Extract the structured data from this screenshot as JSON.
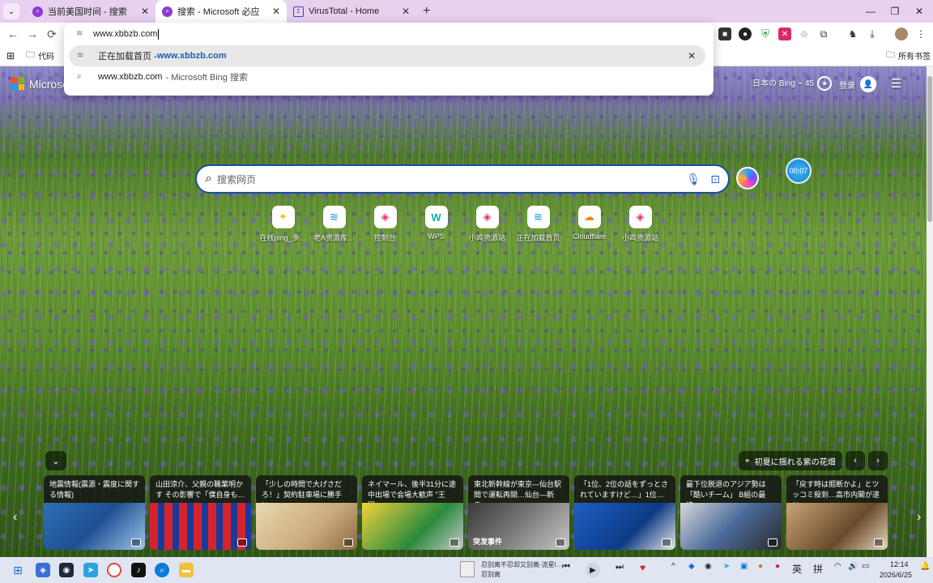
{
  "tabs": [
    {
      "title": "当前美国时间 - 搜索",
      "close": "✕"
    },
    {
      "title": "搜索 - Microsoft 必应",
      "close": "✕"
    },
    {
      "title": "VirusTotal - Home",
      "close": "✕"
    }
  ],
  "new_tab": "+",
  "window": {
    "min": "—",
    "max": "❐",
    "close": "✕"
  },
  "nav": {
    "back": "←",
    "forward": "→",
    "reload": "⟳"
  },
  "bookmarks": {
    "left_folder": "代码",
    "right_folder": "所有书签"
  },
  "omnibox": {
    "input_value": "www.xbbzb.com",
    "suggestions": [
      {
        "prefix": "正在加载首页 - ",
        "url": "www.xbbzb.com",
        "close": "✕"
      },
      {
        "prefix": "www.xbbzb.com",
        "sub": "- Microsoft Bing 搜索"
      }
    ]
  },
  "bing": {
    "brand": "Microsoft",
    "region": "日本の Bing",
    "chevron": "⌄",
    "points": "45",
    "signin": "登录",
    "menu": "☰",
    "search_placeholder": "搜索网页",
    "timer": "00:07"
  },
  "quick_links": [
    {
      "label": "在线ping_多…",
      "glyph": "✦",
      "color": "#f4c20d"
    },
    {
      "label": "老A资源库…",
      "glyph": "≋",
      "color": "#3aa7e6"
    },
    {
      "label": "控制台",
      "glyph": "◈",
      "color": "#e8336f"
    },
    {
      "label": "WPS",
      "glyph": "W",
      "color": "#0bb3a6"
    },
    {
      "label": "小鸡资源站",
      "glyph": "◈",
      "color": "#e8336f"
    },
    {
      "label": "正在加载首页",
      "glyph": "≋",
      "color": "#3aa7e6"
    },
    {
      "label": "Cloudflare",
      "glyph": "☁",
      "color": "#f6821f"
    },
    {
      "label": "小鸡资源站",
      "glyph": "◈",
      "color": "#e8336f"
    }
  ],
  "feed": {
    "toggle": "⌄",
    "caption": "初夏に揺れる紫の花畑",
    "prev": "‹",
    "next": "›"
  },
  "news": [
    {
      "title": "地震情報(震源・震度に関する情報)",
      "img": "linear-gradient(135deg,#2f6fb5,#1e4f92 50%,#9fc4e8)"
    },
    {
      "title": "山田涼介、父親の職業明かす その影響で「僕自身も…",
      "img": "repeating-linear-gradient(90deg,#d6242e 0 10px,#1a3a9a 10px 18px)"
    },
    {
      "title": "「少しの時間で大げさだろ！」契約駐車場に勝手に…",
      "img": "linear-gradient(135deg,#e9d8b0,#c9a97a 60%,#8a6a40)"
    },
    {
      "title": "ネイマール、後半31分に途中出場で会場大歓声 \"王国…",
      "img": "linear-gradient(135deg,#f2d43a,#2a8a3e 60%,#c9c9c9)"
    },
    {
      "title": "東北新幹線が東京―仙台駅間で運転再開…仙台―新青…",
      "img": "linear-gradient(135deg,#3a3a3a,#7a7a7a 50%,#c8c8c8)",
      "tag": "突发事件"
    },
    {
      "title": "「1位、2位の話をずっとされていますけど…」1位…",
      "img": "linear-gradient(135deg,#1e5fc4,#0d3a86 60%,#e8e8e8)"
    },
    {
      "title": "最下位脱退のアジア勢は「酷いチーム」 B組の最終…",
      "img": "linear-gradient(135deg,#d8d8d8,#4a6a9a 50%,#2a2a2a)"
    },
    {
      "title": "「戻す時は掘断かよ」とツッコミ殺到…高市内閣が遂に…",
      "img": "linear-gradient(135deg,#c8a478,#6a4a2a 60%,#e8d8c0)"
    }
  ],
  "taskbar": {
    "media_title": "忍别离不忍却又别离-流星l…",
    "media_artist": "忍别离",
    "ime1": "英",
    "ime2": "拼",
    "time": "12:14",
    "date": "2026/6/25",
    "chevron": "^"
  }
}
